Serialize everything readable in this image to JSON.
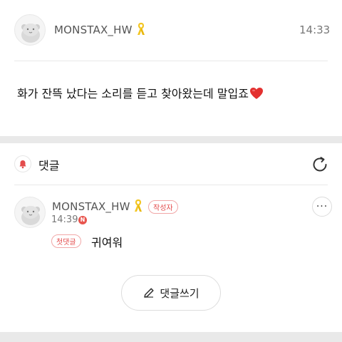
{
  "post": {
    "username": "MONSTAX_HW",
    "time": "14:33",
    "body": "화가 잔뜩 났다는 소리를 듣고 찾아왔는데 말입죠",
    "avatar_icon": "hamster-avatar-icon",
    "ribbon_icon": "yellow-ribbon-icon",
    "heart_icon": "red-heart-emoji"
  },
  "comments": {
    "title": "댓글",
    "bell_icon": "bell-icon",
    "refresh_icon": "refresh-icon",
    "items": [
      {
        "username": "MONSTAX_HW",
        "author_badge": "작성자",
        "time": "14:39",
        "new_badge": "N",
        "first_badge": "첫댓글",
        "text": "귀여워",
        "more_label": "···"
      }
    ]
  },
  "write_comment": {
    "label": "댓글쓰기",
    "icon": "pencil-icon"
  },
  "colors": {
    "accent_red": "#e34b4b",
    "ribbon_yellow": "#f3c623",
    "divider_gray": "#e9e9e9"
  }
}
